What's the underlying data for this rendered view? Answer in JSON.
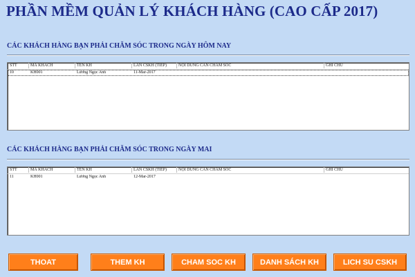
{
  "app": {
    "title": "PHẦN MỀM QUẢN LÝ KHÁCH HÀNG (CAO CẤP 2017)"
  },
  "columns": [
    "STT",
    "MÃ KHÁCH",
    "TÊN KH",
    "LẦN CSKH (TIẾP)",
    "NỘI DUNG CẦN CHĂM SÓC",
    "GHI CHÚ"
  ],
  "today": {
    "title": "CÁC KHÁCH HÀNG BẠN PHẢI CHĂM SÓC TRONG NGÀY HÔM NAY",
    "rows": [
      [
        "10",
        "KH001",
        "Lương Ngọc Anh",
        "11-Mar-2017",
        "",
        ""
      ]
    ]
  },
  "tomorrow": {
    "title": "CÁC KHÁCH HÀNG BẠN PHẢI CHĂM SÓC TRONG NGÀY MAI",
    "rows": [
      [
        "11",
        "KH001",
        "Lương Ngọc Anh",
        "12-Mar-2017",
        "",
        ""
      ]
    ]
  },
  "buttons": {
    "exit": "THOAT",
    "add_customer": "THEM KH",
    "care": "CHAM SOC KH",
    "customer_list": "DANH SÁCH KH",
    "history": "LICH SU CSKH"
  },
  "colors": {
    "background": "#c3daf5",
    "title": "#1c2a8a",
    "button": "#ff7f1a"
  }
}
